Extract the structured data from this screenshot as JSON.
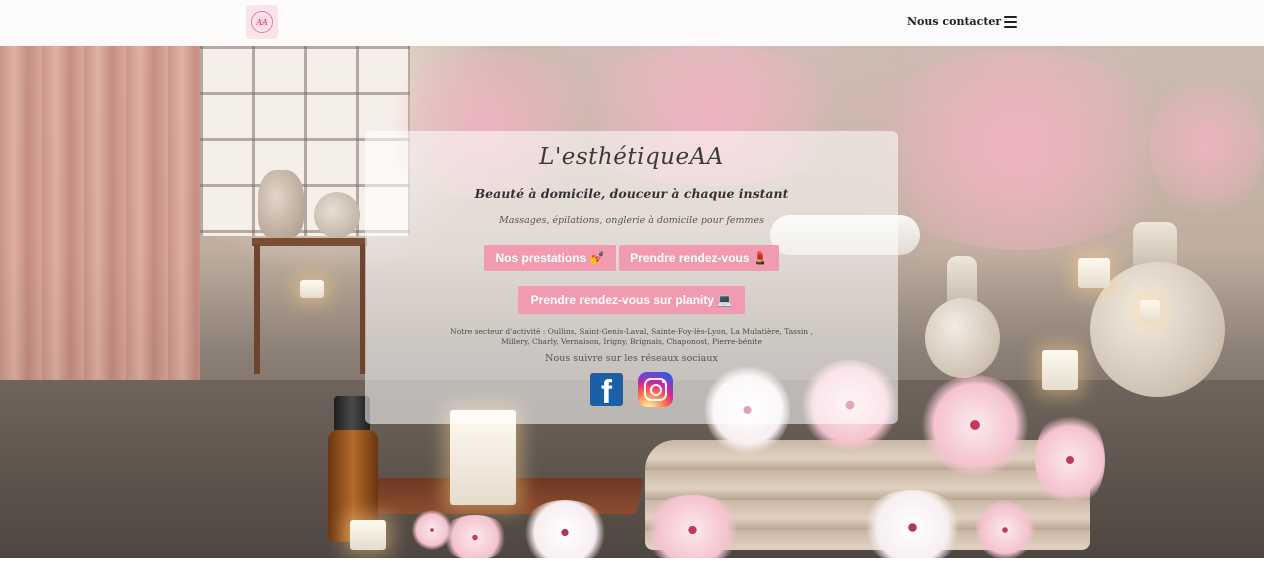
{
  "header": {
    "contact_label": "Nous contacter",
    "menu_icon": "hamburger-menu-icon",
    "logo_mark": "AA"
  },
  "hero": {
    "brand": "L'esthétiqueAA",
    "tagline": "Beauté à domicile, douceur à chaque instant",
    "services": "Massages, épilations, onglerie à domicile pour femmes",
    "buttons": {
      "prestations": "Nos prestations 💅",
      "rdv": "Prendre rendez-vous 💄",
      "planity": "Prendre rendez-vous sur planity 💻"
    },
    "sector": "Notre secteur d'activité : Oullins, Saint-Genis-Laval, Sainte-Foy-lès-Lyon, La Mulatière, Tassin , Millery, Charly, Vernaison, Irigny, Brignais, Chaponost, Pierre-bénite",
    "social_title": "Nous suivre sur les réseaux sociaux",
    "social": {
      "facebook_icon": "facebook-icon",
      "facebook_glyph": "f",
      "instagram_icon": "instagram-icon"
    }
  },
  "colors": {
    "button": "#f09bb0",
    "button_text": "#ffffff",
    "facebook": "#1b5fa6",
    "header_bg": "#ffffff"
  }
}
